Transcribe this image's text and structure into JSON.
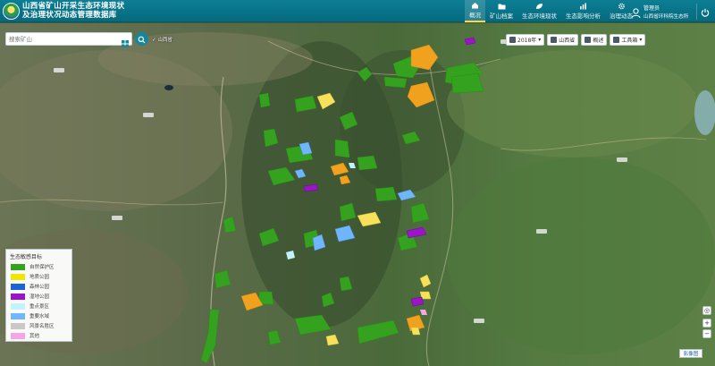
{
  "header": {
    "title_line1": "山西省矿山开采生态环境现状",
    "title_line2": "及治理状况动态管理数据库"
  },
  "nav": [
    {
      "label": "概况",
      "icon": "home-icon"
    },
    {
      "label": "矿山档案",
      "icon": "folder-icon"
    },
    {
      "label": "生态环境现状",
      "icon": "leaf-icon"
    },
    {
      "label": "生态影响分析",
      "icon": "chart-icon"
    },
    {
      "label": "治理动态",
      "icon": "gear-icon"
    }
  ],
  "user": {
    "role": "管理员",
    "org": "山西省环科院生态所"
  },
  "search": {
    "placeholder": "搜索矿山"
  },
  "location": "✓ 山西省",
  "toolbar": {
    "year": "2018年",
    "region": "山西省",
    "overview": "概述",
    "tools": "工具箱"
  },
  "legend": {
    "title": "生态敏感目标",
    "items": [
      {
        "label": "自然保护区",
        "color": "#35a21f"
      },
      {
        "label": "地质公园",
        "color": "#f2e600"
      },
      {
        "label": "森林公园",
        "color": "#1e63d6"
      },
      {
        "label": "湿地公园",
        "color": "#9a14c8"
      },
      {
        "label": "重点景区",
        "color": "#c3f2ff"
      },
      {
        "label": "重要水域",
        "color": "#6fb6ff"
      },
      {
        "label": "风景名胜区",
        "color": "#c9c9c9"
      },
      {
        "label": "其他",
        "color": "#f4a6e6"
      }
    ]
  },
  "map_controls": {
    "zoom_in": "+",
    "zoom_out": "−",
    "minimap": "影像图"
  },
  "colors": {
    "header": "#0a7489",
    "accent": "#ffd54a",
    "reserve": "#35a21f",
    "geopark": "#f7c948",
    "orange": "#f0a21e"
  }
}
